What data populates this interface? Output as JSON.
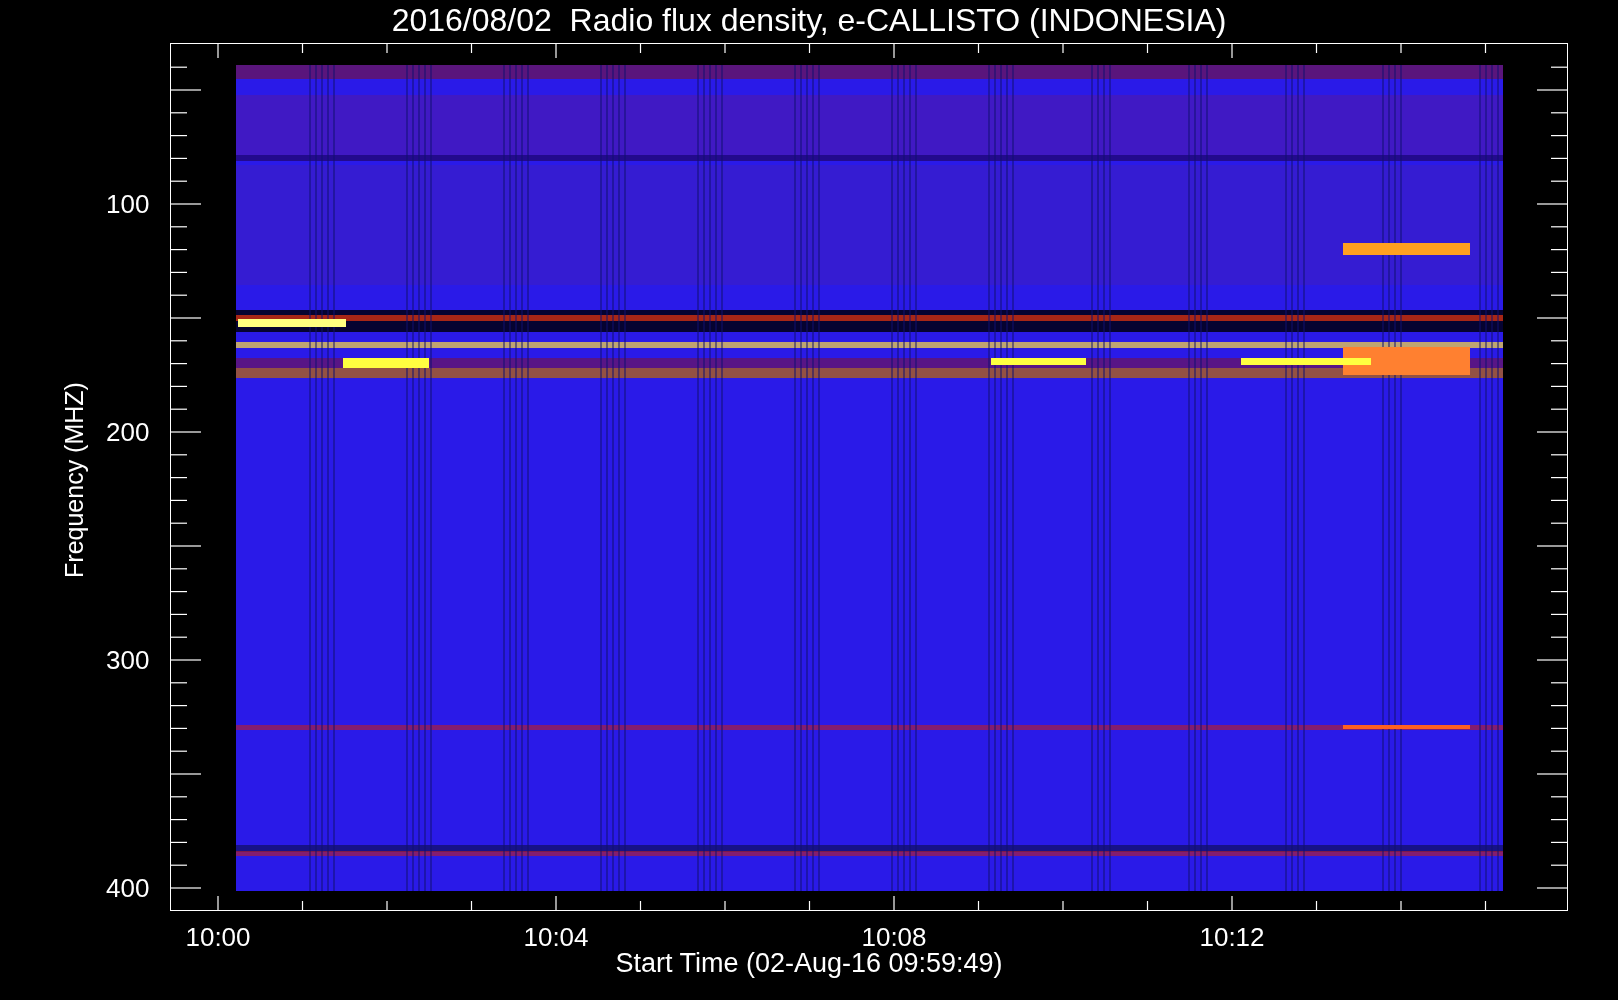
{
  "title": "2016/08/02  Radio flux density, e-CALLISTO (INDONESIA)",
  "y_axis": {
    "label": "Frequency (MHZ)",
    "ticks": [
      "100",
      "200",
      "300",
      "400"
    ]
  },
  "x_axis": {
    "label": "Start Time (02-Aug-16 09:59:49)",
    "ticks": [
      "10:00",
      "10:04",
      "10:08",
      "10:12"
    ]
  }
}
